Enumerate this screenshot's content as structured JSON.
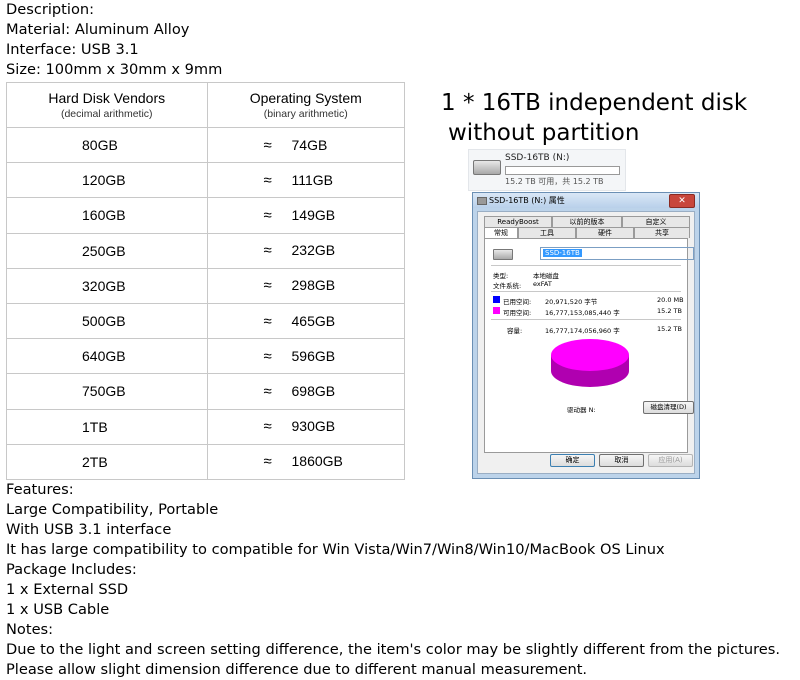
{
  "intro": {
    "description": "Description:",
    "material": "Material: Aluminum Alloy",
    "interface": "Interface: USB 3.1",
    "size": "Size: 100mm x 30mm x 9mm"
  },
  "capacity_table": {
    "headers": [
      {
        "title": "Hard Disk Vendors",
        "sub": "(decimal arithmetic)"
      },
      {
        "title": "Operating System",
        "sub": "(binary arithmetic)"
      }
    ],
    "approx_symbol": "≈",
    "rows": [
      {
        "vendor": "80GB",
        "os": "74GB"
      },
      {
        "vendor": "120GB",
        "os": "111GB"
      },
      {
        "vendor": "160GB",
        "os": "149GB"
      },
      {
        "vendor": "250GB",
        "os": "232GB"
      },
      {
        "vendor": "320GB",
        "os": "298GB"
      },
      {
        "vendor": "500GB",
        "os": "465GB"
      },
      {
        "vendor": "640GB",
        "os": "596GB"
      },
      {
        "vendor": "750GB",
        "os": "698GB"
      },
      {
        "vendor": "1TB",
        "os": "930GB"
      },
      {
        "vendor": "2TB",
        "os": "1860GB"
      }
    ]
  },
  "headline": {
    "line1": "1 * 16TB independent disk",
    "line2": "without partition"
  },
  "drive_tile": {
    "name": "SSD-16TB (N:)",
    "free": "15.2 TB 可用，共 15.2 TB",
    "used_fraction": 0.0
  },
  "properties_dialog": {
    "title": "SSD-16TB (N:) 属性",
    "close": "✕",
    "tabs_row1": [
      "ReadyBoost",
      "以前的版本",
      "自定义"
    ],
    "tabs_row2": [
      "常规",
      "工具",
      "硬件",
      "共享"
    ],
    "volume_name": "SSD-16TB",
    "type_label": "类型:",
    "type_value": "本地磁盘",
    "fs_label": "文件系统:",
    "fs_value": "exFAT",
    "used_label": "已用空间:",
    "used_bytes": "20,971,520 字节",
    "used_size": "20.0 MB",
    "free_label": "可用空间:",
    "free_bytes": "16,777,153,085,440 字",
    "free_size": "15.2 TB",
    "capacity_label": "容量:",
    "capacity_bytes": "16,777,174,056,960 字",
    "capacity_size": "15.2 TB",
    "drive_label": "驱动器 N:",
    "cleanup_button": "磁盘清理(D)",
    "ok_button": "确定",
    "cancel_button": "取消",
    "apply_button": "应用(A)",
    "colors": {
      "used": "#0000ff",
      "free": "#ff00ff",
      "pie": "#ff00ff",
      "pie_side": "#b000b0"
    }
  },
  "features": {
    "heading": "Features:",
    "line1": "Large Compatibility, Portable",
    "line2": "With USB 3.1 interface",
    "line3": "It has large compatibility to compatible for Win Vista/Win7/Win8/Win10/MacBook OS Linux"
  },
  "package": {
    "heading": "Package Includes:",
    "item1": "1 x External SSD",
    "item2": "1 x USB Cable"
  },
  "notes": {
    "heading": "Notes:",
    "line1": "Due to the light and screen setting difference, the item's color may be slightly different from the pictures.",
    "line2": "Please allow slight dimension difference due to different manual measurement."
  }
}
